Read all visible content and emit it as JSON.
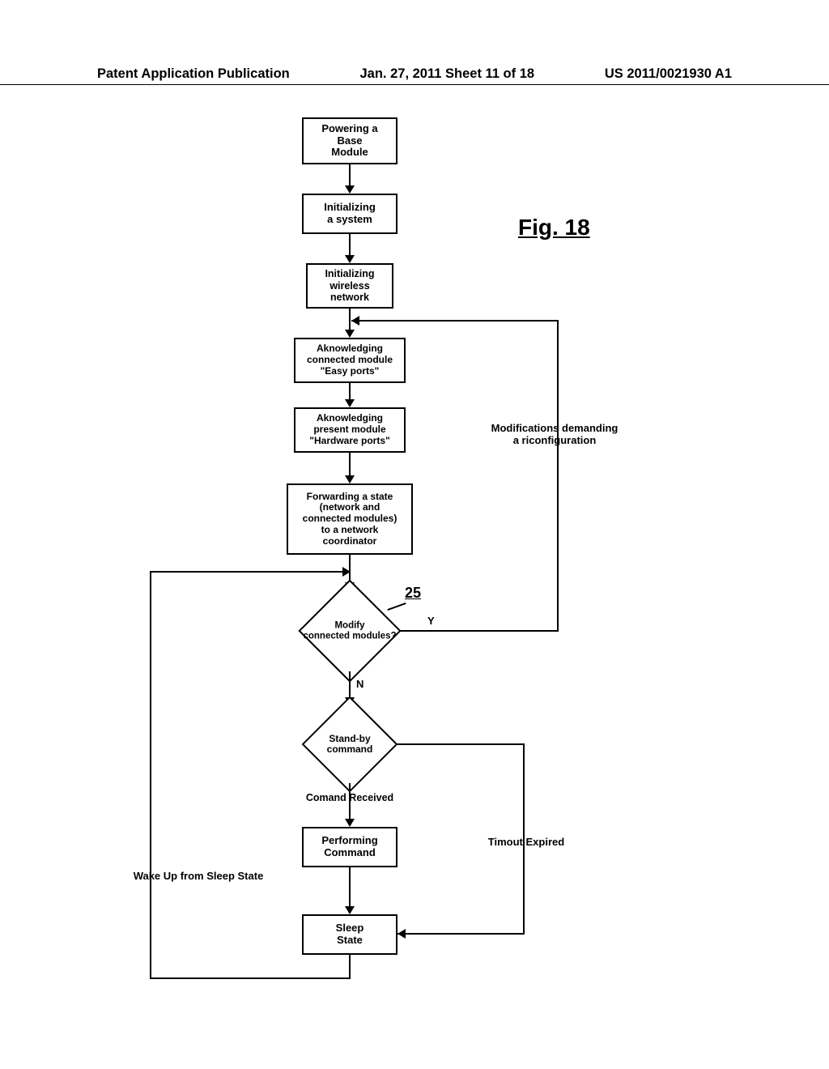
{
  "header": {
    "left": "Patent Application Publication",
    "center": "Jan. 27, 2011  Sheet 11 of 18",
    "right": "US 2011/0021930 A1"
  },
  "figure_label": "Fig. 18",
  "refnum": "25",
  "boxes": {
    "b1": "Powering a\nBase\nModule",
    "b2": "Initializing\na system",
    "b3": "Initializing\nwireless\nnetwork",
    "b4": "Aknowledging\nconnected module\n\"Easy ports\"",
    "b5": "Aknowledging\npresent module\n\"Hardware ports\"",
    "b6": "Forwarding a state\n(network and\nconnected modules)\nto a network\ncoordinator",
    "b7": "Performing\nCommand",
    "b8": "Sleep\nState"
  },
  "diamonds": {
    "d1": "Modify\nconnected modules?",
    "d2": "Stand-by\ncommand"
  },
  "labels": {
    "y": "Y",
    "n": "N",
    "modifications": "Modifications demanding\na riconfiguration",
    "cmd_received": "Comand Received",
    "timeout": "Timout Expired",
    "wakeup": "Wake Up from Sleep State"
  }
}
